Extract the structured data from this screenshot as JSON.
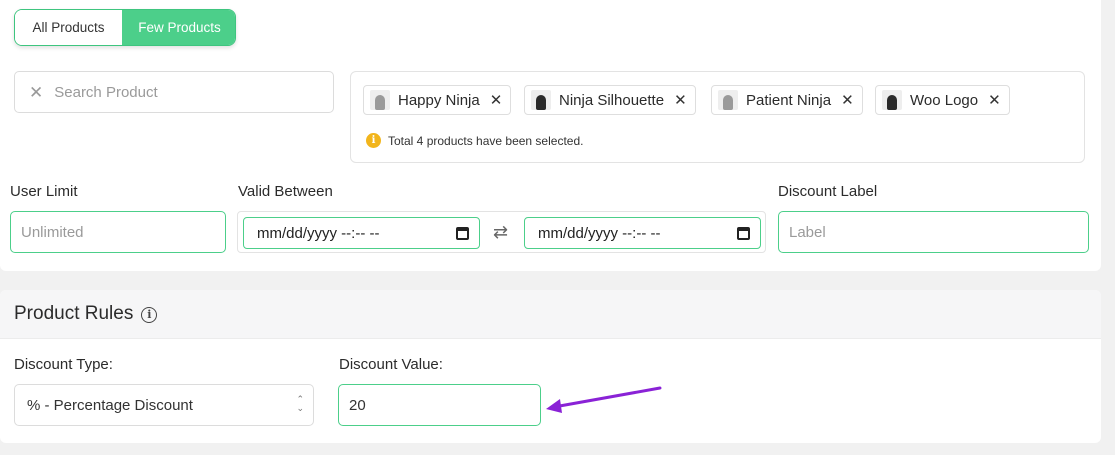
{
  "toggle": {
    "all_label": "All Products",
    "few_label": "Few Products"
  },
  "search": {
    "placeholder": "Search Product"
  },
  "selected_products": {
    "items": [
      {
        "name": "Happy Ninja",
        "thumb": "light"
      },
      {
        "name": "Ninja Silhouette",
        "thumb": "dark"
      },
      {
        "name": "Patient Ninja",
        "thumb": "light"
      },
      {
        "name": "Woo Logo",
        "thumb": "dark"
      }
    ],
    "notice": "Total 4 products have been selected."
  },
  "user_limit": {
    "label": "User Limit",
    "placeholder": "Unlimited"
  },
  "valid_between": {
    "label": "Valid Between",
    "start_value": "mm/dd/yyyy --:-- --",
    "end_value": "mm/dd/yyyy --:-- --"
  },
  "discount_label": {
    "label": "Discount Label",
    "placeholder": "Label"
  },
  "product_rules": {
    "title": "Product Rules",
    "discount_type_label": "Discount Type:",
    "discount_type_value": "% - Percentage Discount",
    "discount_value_label": "Discount Value:",
    "discount_value": "20"
  },
  "colors": {
    "accent_green": "#4ccf8a",
    "annotation_arrow": "#8a22d6",
    "notice_yellow": "#f2b51c"
  }
}
